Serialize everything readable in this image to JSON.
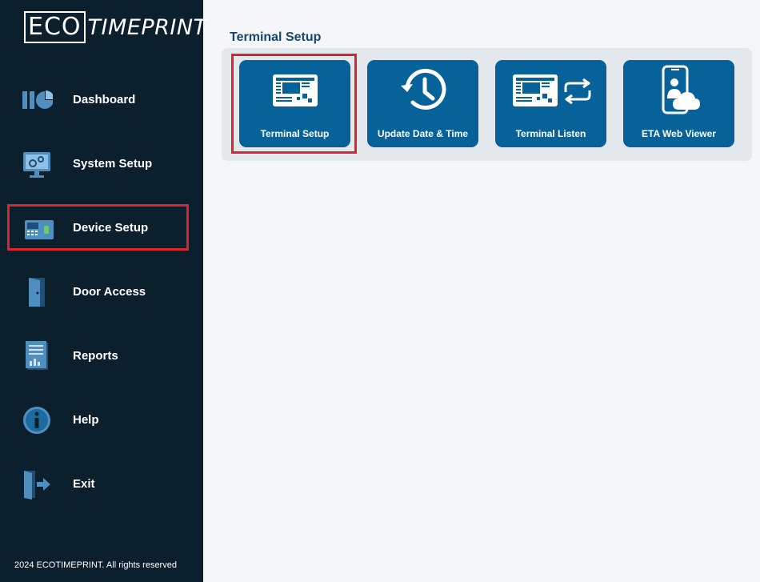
{
  "brand": {
    "logo_eco": "ECO",
    "logo_timeprint": "TIMEPRINT"
  },
  "sidebar": {
    "items": [
      {
        "label": "Dashboard",
        "icon": "dashboard-chart-icon"
      },
      {
        "label": "System Setup",
        "icon": "monitor-gears-icon"
      },
      {
        "label": "Device Setup",
        "icon": "terminal-device-icon"
      },
      {
        "label": "Door Access",
        "icon": "door-icon"
      },
      {
        "label": "Reports",
        "icon": "report-document-icon"
      },
      {
        "label": "Help",
        "icon": "info-icon"
      },
      {
        "label": "Exit",
        "icon": "exit-door-icon"
      }
    ],
    "active": "Device Setup"
  },
  "footer": {
    "copyright": "2024 ECOTIMEPRINT. All rights reserved"
  },
  "main": {
    "title": "Terminal Setup",
    "tiles": [
      {
        "label": "Terminal Setup",
        "icon": "terminal-icon"
      },
      {
        "label": "Update Date & Time",
        "icon": "clock-history-icon"
      },
      {
        "label": "Terminal Listen",
        "icon": "terminal-sync-icon"
      },
      {
        "label": "ETA Web Viewer",
        "icon": "phone-user-cloud-icon"
      }
    ],
    "highlighted_tile": "Terminal Setup"
  },
  "colors": {
    "sidebar_bg": "#0b1f2d",
    "tile_bg": "#07629a",
    "highlight": "#d9262e",
    "title": "#17466b",
    "icon_accent": "#4f8fc0"
  }
}
